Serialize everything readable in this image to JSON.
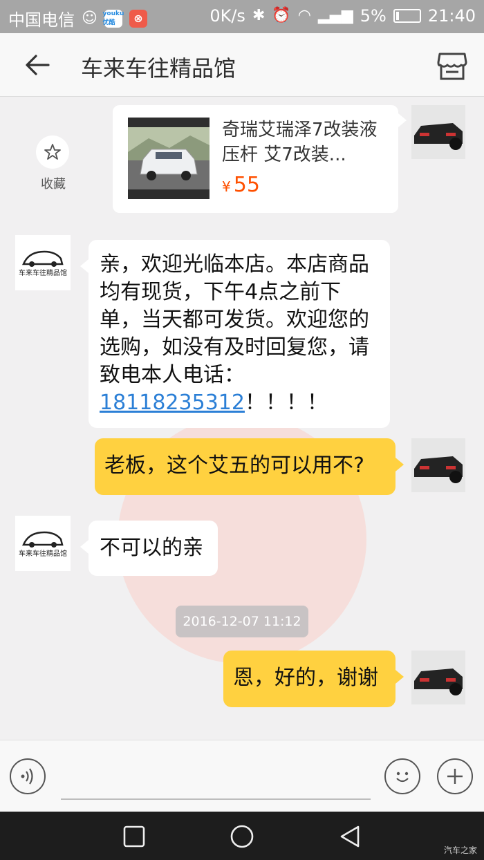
{
  "status_bar": {
    "carrier": "中国电信",
    "app_badge_1": "youku 优酷",
    "net_speed": "0K/s",
    "battery": "5%",
    "time": "21:40"
  },
  "header": {
    "title": "车来车往精品馆"
  },
  "favorite": {
    "label": "收藏"
  },
  "product_card": {
    "title": "奇瑞艾瑞泽7改装液压杆 艾7改装...",
    "currency": "¥",
    "price": "55"
  },
  "shop": {
    "avatar_text": "车来车往精品馆"
  },
  "messages": {
    "shop_welcome_text": "亲，欢迎光临本店。本店商品均有现货，下午4点之前下单，当天都可发货。欢迎您的选购，如没有及时回复您，请致电本人电话：",
    "shop_welcome_phone": "18118235312",
    "shop_welcome_suffix": "！！！！",
    "user_question": "老板，这个艾五的可以用不?",
    "shop_answer": "不可以的亲",
    "timestamp": "2016-12-07 11:12",
    "user_reply": "恩，好的，谢谢"
  },
  "footer_mark": "汽车之家",
  "colors": {
    "accent_yellow": "#ffd140",
    "price_orange": "#ff5000",
    "link_blue": "#2b7fd6"
  }
}
